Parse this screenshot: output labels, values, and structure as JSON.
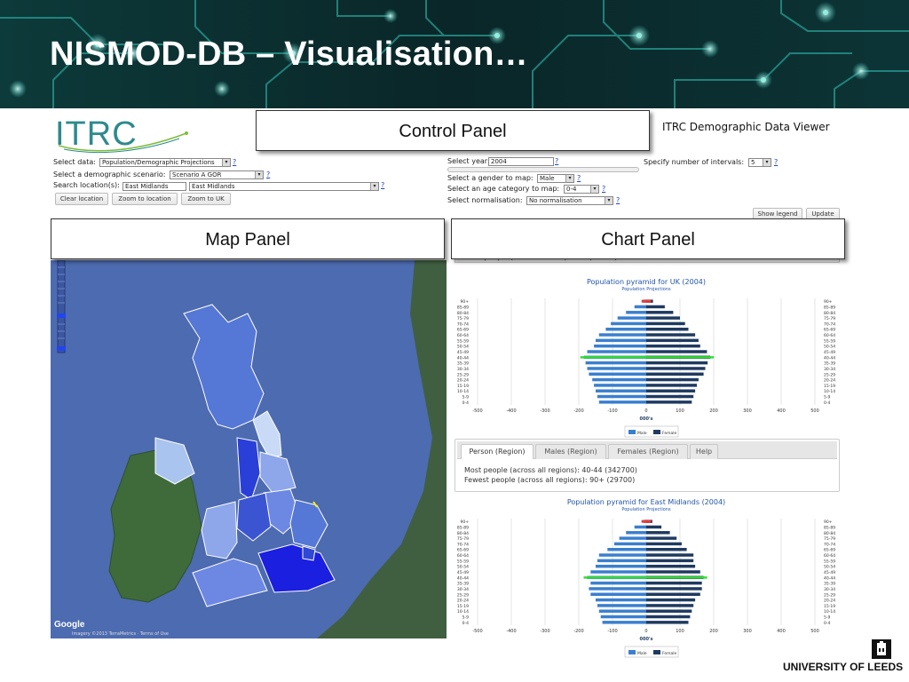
{
  "slide": {
    "title": "NISMOD-DB – Visualisation…"
  },
  "app": {
    "logo": "ITRC",
    "viewer_title": "ITRC Demographic Data Viewer"
  },
  "callouts": {
    "control": "Control Panel",
    "map": "Map Panel",
    "chart": "Chart Panel"
  },
  "controls": {
    "select_data_label": "Select data:",
    "select_data_value": "Population/Demographic Projections",
    "scenario_label": "Select a demographic scenario:",
    "scenario_value": "Scenario A GOR",
    "search_label": "Search location(s):",
    "search_value": "East Midlands",
    "search_select_value": "East Midlands",
    "clear_button": "Clear location",
    "zoom_location_button": "Zoom to location",
    "zoom_uk_button": "Zoom to UK",
    "year_label": "Select year:",
    "year_value": "2004",
    "intervals_label": "Specify number of intervals:",
    "intervals_value": "5",
    "gender_label": "Select a gender to map:",
    "gender_value": "Male",
    "age_label": "Select an age category to map:",
    "age_value": "0-4",
    "normalisation_label": "Select normalisation:",
    "normalisation_value": "No normalisation",
    "show_legend_button": "Show legend",
    "update_button": "Update",
    "help_q": "?"
  },
  "map": {
    "google": "Google",
    "imagery": "Imagery ©2013 TerraMetrics · Terms of Use"
  },
  "stats_top": "Fewest people (from UK mean): 90+ (34221)",
  "tabs": [
    "Person (Region)",
    "Males (Region)",
    "Females (Region)",
    "Help"
  ],
  "stats_region": {
    "most": "Most people (across all regions): 40-44 (342700)",
    "fewest": "Fewest people (across all regions): 90+ (29700)"
  },
  "colors": {
    "male": "#3a7fcf",
    "female": "#1f3a5f",
    "highlight_green": "#33dd33",
    "highlight_red": "#e83a3a",
    "chart_title": "#2255aa"
  },
  "chart_data": [
    {
      "type": "bar",
      "title": "Population pyramid for UK (2004)",
      "subtitle": "Population Projections",
      "xlabel": "000's",
      "xlim": [
        -500,
        500
      ],
      "xticks": [
        "-500",
        "-400",
        "-300",
        "-200",
        "-100",
        "0",
        "100",
        "200",
        "300",
        "400",
        "500"
      ],
      "categories": [
        "0-4",
        "5-9",
        "10-14",
        "15-19",
        "20-24",
        "25-29",
        "30-34",
        "35-39",
        "40-44",
        "45-49",
        "50-54",
        "55-59",
        "60-64",
        "65-69",
        "70-74",
        "75-79",
        "80-84",
        "85-89",
        "90+"
      ],
      "series": [
        {
          "name": "Male",
          "values": [
            -140,
            -145,
            -150,
            -155,
            -160,
            -170,
            -175,
            -180,
            -185,
            -175,
            -155,
            -150,
            -140,
            -120,
            -105,
            -85,
            -60,
            -35,
            -10
          ]
        },
        {
          "name": "Female",
          "values": [
            135,
            140,
            145,
            150,
            155,
            170,
            175,
            182,
            190,
            180,
            160,
            155,
            145,
            125,
            115,
            100,
            80,
            55,
            20
          ]
        }
      ],
      "legend": [
        "Male",
        "Female"
      ]
    },
    {
      "type": "bar",
      "title": "Population pyramid for East Midlands (2004)",
      "subtitle": "Population Projections",
      "xlabel": "000's",
      "xlim": [
        -500,
        500
      ],
      "xticks": [
        "-500",
        "-400",
        "-300",
        "-200",
        "-100",
        "0",
        "100",
        "200",
        "300",
        "400",
        "500"
      ],
      "categories": [
        "0-4",
        "5-9",
        "10-14",
        "15-19",
        "20-24",
        "25-29",
        "30-34",
        "35-39",
        "40-44",
        "45-49",
        "50-54",
        "55-59",
        "60-64",
        "65-69",
        "70-74",
        "75-79",
        "80-84",
        "85-89",
        "90+"
      ],
      "series": [
        {
          "name": "Male",
          "values": [
            -130,
            -135,
            -140,
            -145,
            -150,
            -165,
            -170,
            -165,
            -175,
            -165,
            -150,
            -145,
            -140,
            -115,
            -95,
            -80,
            -60,
            -35,
            -8
          ]
        },
        {
          "name": "Female",
          "values": [
            125,
            130,
            135,
            140,
            145,
            160,
            165,
            165,
            170,
            160,
            145,
            140,
            140,
            120,
            105,
            90,
            70,
            45,
            18
          ]
        }
      ],
      "legend": [
        "Male",
        "Female"
      ]
    }
  ],
  "footer": {
    "university": "UNIVERSITY OF LEEDS"
  }
}
